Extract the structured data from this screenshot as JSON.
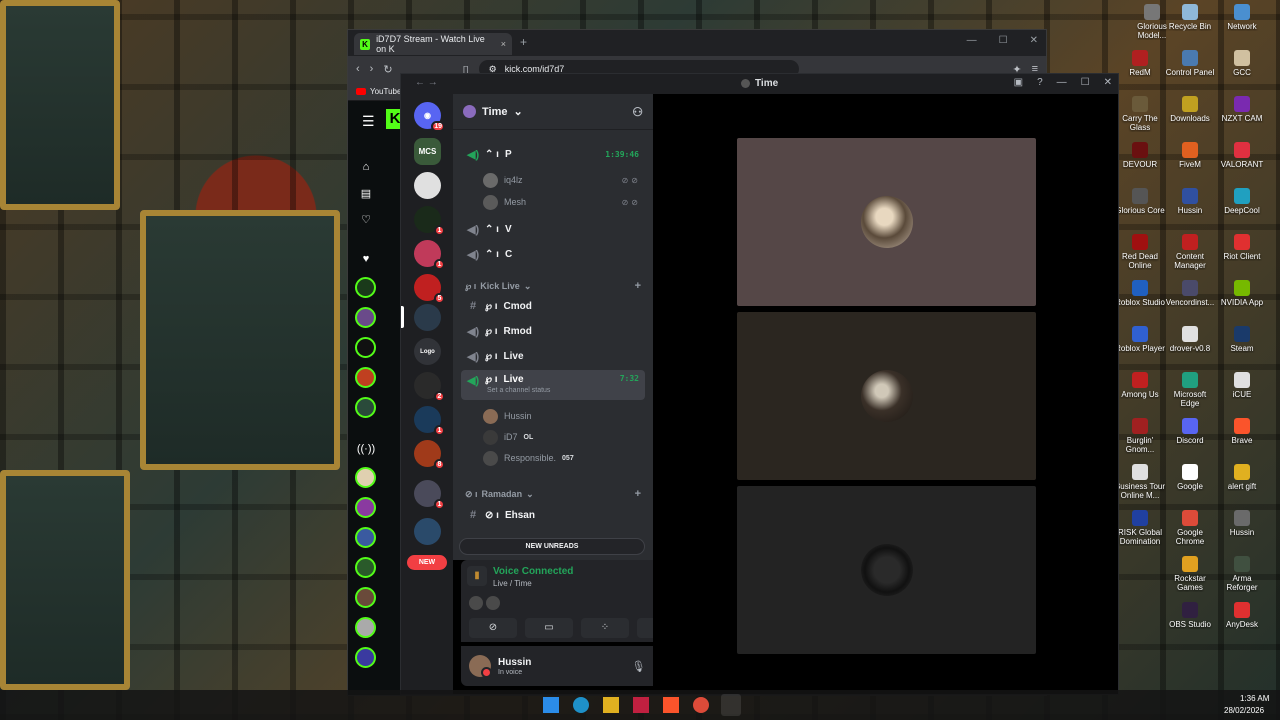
{
  "browser": {
    "tab_title": "iD7D7 Stream - Watch Live on K",
    "tab_close": "×",
    "new_tab": "+",
    "url": "kick.com/id7d7",
    "bookmark": "YouTube",
    "kick_logo": "K"
  },
  "discord": {
    "window_title": "Time",
    "server_name": "Time",
    "channels": [
      {
        "name": "P",
        "timer": "1:39:46"
      },
      {
        "name": "V"
      },
      {
        "name": "C"
      }
    ],
    "p_users": [
      "iq4lz",
      "Mesh"
    ],
    "category_kick_live": "Kick Live",
    "kick_live_channels": [
      "Cmod",
      "Rmod",
      "Live"
    ],
    "selected_channel": {
      "name": "Live",
      "timer": "7:32",
      "status_placeholder": "Set a channel status"
    },
    "live_users": [
      {
        "name": "Hussin",
        "tag": ""
      },
      {
        "name": "iD7",
        "tag": "OL"
      },
      {
        "name": "Responsible.",
        "tag": "057"
      }
    ],
    "category_ramadan": "Ramadan",
    "ramadan_channels": [
      "Ehsan"
    ],
    "new_unreads": "NEW UNREADS",
    "new_pill": "NEW",
    "guild_badges": [
      "19",
      "1",
      "1",
      "5",
      "2",
      "1",
      "8",
      "1"
    ],
    "guild_labels": {
      "mcs": "MCS",
      "logo": "Logo"
    },
    "voice_panel": {
      "title": "Voice Connected",
      "subtitle": "Live / Time"
    },
    "user_panel": {
      "name": "Hussin",
      "status": "In voice"
    }
  },
  "taskbar": {
    "time": "1:36 AM",
    "date": "28/02/2026"
  },
  "desktop_icons": [
    {
      "label": "Glorious Model..."
    },
    {
      "label": "Recycle Bin"
    },
    {
      "label": "Network"
    },
    {
      "label": "RedM"
    },
    {
      "label": "Control Panel"
    },
    {
      "label": "GCC"
    },
    {
      "label": "Carry The Glass"
    },
    {
      "label": "Downloads"
    },
    {
      "label": "NZXT CAM"
    },
    {
      "label": "DEVOUR"
    },
    {
      "label": "FiveM"
    },
    {
      "label": "VALORANT"
    },
    {
      "label": "Glorious Core"
    },
    {
      "label": "Hussin"
    },
    {
      "label": "DeepCool"
    },
    {
      "label": "Red Dead Online"
    },
    {
      "label": "Content Manager"
    },
    {
      "label": "Riot Client"
    },
    {
      "label": "Roblox Studio"
    },
    {
      "label": "Vencordinst..."
    },
    {
      "label": "NVIDIA App"
    },
    {
      "label": "Roblox Player"
    },
    {
      "label": "drover-v0.8"
    },
    {
      "label": "Steam"
    },
    {
      "label": "Among Us"
    },
    {
      "label": "Microsoft Edge"
    },
    {
      "label": "iCUE"
    },
    {
      "label": "Burglin' Gnom..."
    },
    {
      "label": "Discord"
    },
    {
      "label": "Brave"
    },
    {
      "label": "Business Tour Online M..."
    },
    {
      "label": "Google"
    },
    {
      "label": "alert gift"
    },
    {
      "label": "RISK Global Domination"
    },
    {
      "label": "Google Chrome"
    },
    {
      "label": "Hussin"
    },
    {
      "label": "Rockstar Games"
    },
    {
      "label": "Arma Reforger"
    },
    {
      "label": "OBS Studio"
    },
    {
      "label": "AnyDesk"
    }
  ]
}
